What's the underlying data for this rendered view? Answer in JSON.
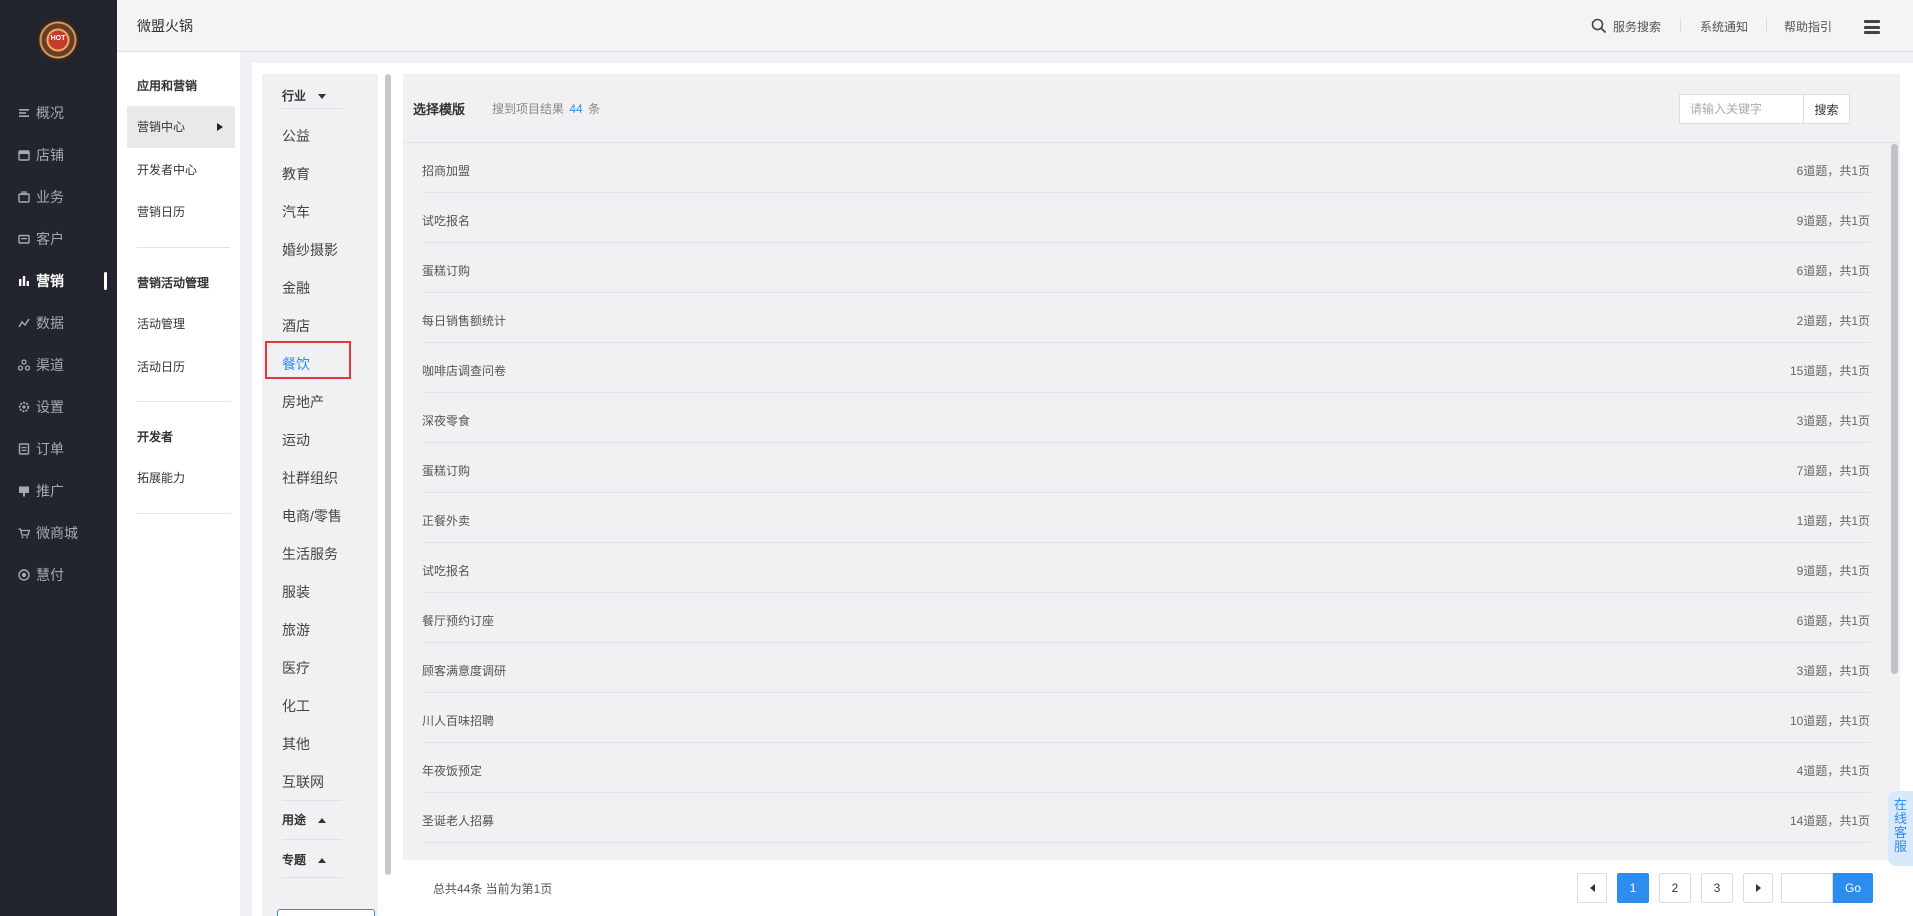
{
  "app": {
    "logo_text": "HOT",
    "store_name": "微盟火锅"
  },
  "sidebar": {
    "items": [
      {
        "label": "概况",
        "icon": "overview-icon"
      },
      {
        "label": "店铺",
        "icon": "store-icon"
      },
      {
        "label": "业务",
        "icon": "business-icon"
      },
      {
        "label": "客户",
        "icon": "customer-icon"
      },
      {
        "label": "营销",
        "icon": "marketing-icon",
        "active": true
      },
      {
        "label": "数据",
        "icon": "data-icon"
      },
      {
        "label": "渠道",
        "icon": "channel-icon"
      },
      {
        "label": "设置",
        "icon": "settings-icon"
      },
      {
        "label": "订单",
        "icon": "order-icon"
      },
      {
        "label": "推广",
        "icon": "promotion-icon"
      },
      {
        "label": "微商城",
        "icon": "mall-icon"
      },
      {
        "label": "慧付",
        "icon": "pay-icon"
      }
    ]
  },
  "header": {
    "service_search": "服务搜索",
    "notifications": "系统通知",
    "help": "帮助指引"
  },
  "submenu": {
    "group1": "应用和营销",
    "g1_items": [
      "营销中心",
      "开发者中心",
      "营销日历"
    ],
    "group2": "营销活动管理",
    "g2_items": [
      "活动管理",
      "活动日历"
    ],
    "group3": "开发者",
    "g3_items": [
      "拓展能力"
    ]
  },
  "categories": {
    "industry_label": "行业",
    "items": [
      "公益",
      "教育",
      "汽车",
      "婚纱摄影",
      "金融",
      "酒店",
      "餐饮",
      "房地产",
      "运动",
      "社群组织",
      "电商/零售",
      "生活服务",
      "服装",
      "旅游",
      "医疗",
      "化工",
      "其他",
      "互联网"
    ],
    "selected": "餐饮",
    "purpose_label": "用途",
    "topic_label": "专题"
  },
  "templates": {
    "title": "选择模版",
    "result_prefix": "搜到项目结果",
    "result_count": "44",
    "result_suffix": "条",
    "search_placeholder": "请输入关键字",
    "search_button": "搜索",
    "rows": [
      {
        "name": "招商加盟",
        "meta": "6道题，共1页"
      },
      {
        "name": "试吃报名",
        "meta": "9道题，共1页"
      },
      {
        "name": "蛋糕订购",
        "meta": "6道题，共1页"
      },
      {
        "name": "每日销售额统计",
        "meta": "2道题，共1页"
      },
      {
        "name": "咖啡店调查问卷",
        "meta": "15道题，共1页"
      },
      {
        "name": "深夜零食",
        "meta": "3道题，共1页"
      },
      {
        "name": "蛋糕订购",
        "meta": "7道题，共1页"
      },
      {
        "name": "正餐外卖",
        "meta": "1道题，共1页"
      },
      {
        "name": "试吃报名",
        "meta": "9道题，共1页"
      },
      {
        "name": "餐厅预约订座",
        "meta": "6道题，共1页"
      },
      {
        "name": "顾客满意度调研",
        "meta": "3道题，共1页"
      },
      {
        "name": "川人百味招聘",
        "meta": "10道题，共1页"
      },
      {
        "name": "年夜饭预定",
        "meta": "4道题，共1页"
      },
      {
        "name": "圣诞老人招募",
        "meta": "14道题，共1页"
      }
    ]
  },
  "pagination": {
    "summary": "总共44条 当前为第1页",
    "pages": [
      "1",
      "2",
      "3"
    ],
    "current": "1",
    "go_label": "Go"
  },
  "chat": {
    "label": "在线客服"
  },
  "colors": {
    "accent": "#2d8cf0",
    "sidebar_bg": "#22252e",
    "highlight_box": "#e23a3a"
  }
}
